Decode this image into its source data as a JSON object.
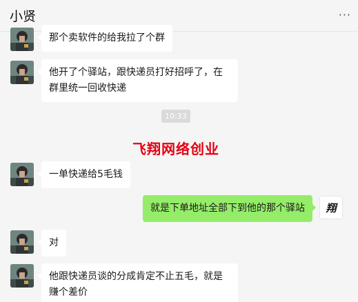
{
  "window": {
    "title": "小贤",
    "more_label": "···"
  },
  "messages": [
    {
      "sender": "contact",
      "text": "那个卖软件的给我拉了个群"
    },
    {
      "sender": "contact",
      "text": "他开了个驿站，跟快递员打好招呼了，在群里统一回收快递"
    },
    {
      "sender": "contact",
      "text": "一单快递给5毛钱"
    },
    {
      "sender": "me",
      "text": "就是下单地址全部下到他的那个驿站"
    },
    {
      "sender": "contact",
      "text": "对"
    },
    {
      "sender": "contact",
      "text": "他跟快递员谈的分成肯定不止五毛，就是赚个差价"
    }
  ],
  "timestamp": "10:33",
  "watermark": "飞翔网络创业",
  "my_avatar_text": "翔",
  "colors": {
    "background": "#f5f5f5",
    "my_bubble": "#95ec69",
    "their_bubble": "#ffffff",
    "watermark": "#e50012"
  }
}
